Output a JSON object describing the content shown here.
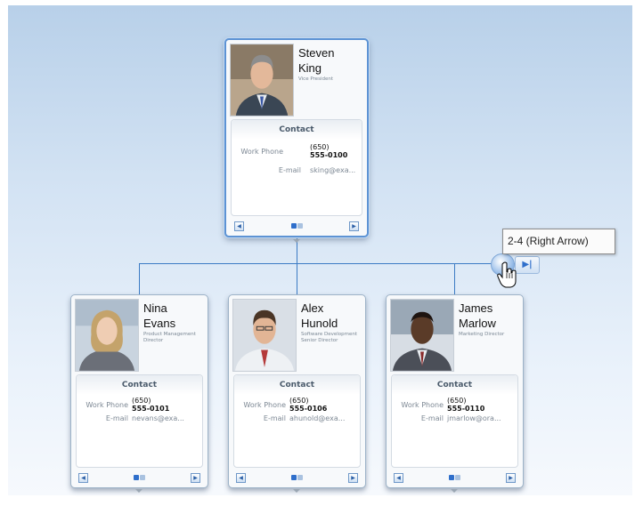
{
  "tooltip": {
    "text": "2-4 (Right Arrow)"
  },
  "scroll": {
    "end_icon": "last-page-icon",
    "cursor_icon": "hand-pointer-icon"
  },
  "colors": {
    "connector": "#3b7bc4",
    "accent": "#2f6fcb",
    "card_border": "#9db3c8"
  },
  "root": {
    "first_name": "Steven",
    "last_name": "King",
    "title": "Vice President",
    "contact_heading": "Contact",
    "phone_label": "Work Phone",
    "phone_line1": "(650)",
    "phone_line2": "555-0100",
    "email_label": "E-mail",
    "email": "sking@exa..."
  },
  "reports": [
    {
      "first_name": "Nina",
      "last_name": "Evans",
      "title": "Product Management Director",
      "contact_heading": "Contact",
      "phone_label": "Work Phone",
      "phone_line1": "(650)",
      "phone_line2": "555-0101",
      "email_label": "E-mail",
      "email": "nevans@exa..."
    },
    {
      "first_name": "Alex",
      "last_name": "Hunold",
      "title": "Software Development Senior Director",
      "contact_heading": "Contact",
      "phone_label": "Work Phone",
      "phone_line1": "(650)",
      "phone_line2": "555-0106",
      "email_label": "E-mail",
      "email": "ahunold@exa..."
    },
    {
      "first_name": "James",
      "last_name": "Marlow",
      "title": "Marketing Director",
      "contact_heading": "Contact",
      "phone_label": "Work Phone",
      "phone_line1": "(650)",
      "phone_line2": "555-0110",
      "email_label": "E-mail",
      "email": "jmarlow@ora..."
    }
  ]
}
